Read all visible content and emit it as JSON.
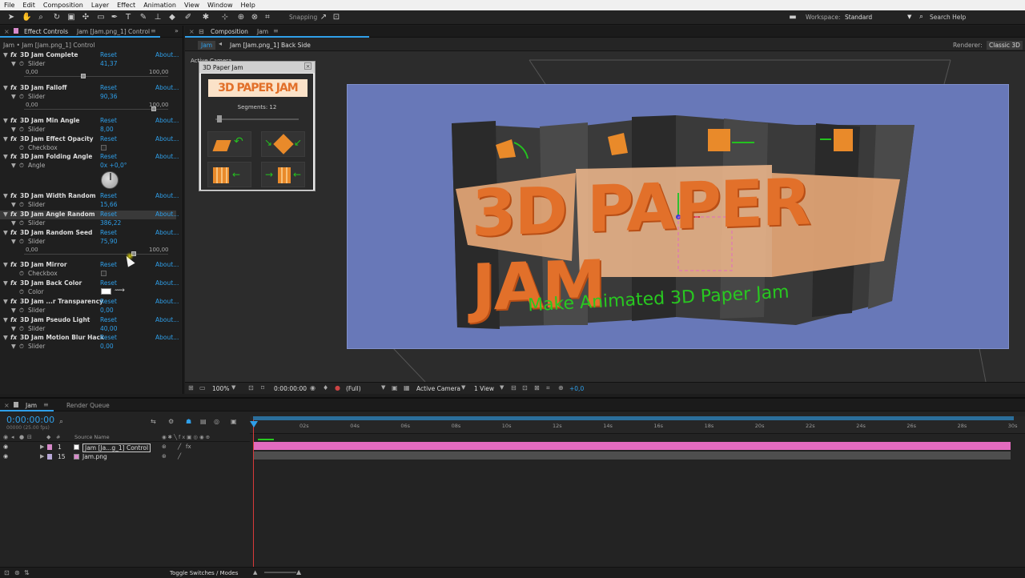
{
  "menu": [
    "File",
    "Edit",
    "Composition",
    "Layer",
    "Effect",
    "Animation",
    "View",
    "Window",
    "Help"
  ],
  "toolbar": {
    "snapping_label": "Snapping",
    "workspace_label": "Workspace:",
    "workspace_value": "Standard",
    "search_placeholder": "Search Help"
  },
  "effect_panel": {
    "tab_label": "Effect Controls",
    "tab_target": "Jam [Jam.png_1] Control",
    "header": "Jam • Jam [Jam.png_1] Control",
    "reset": "Reset",
    "about": "About...",
    "effects": [
      {
        "name": "3D Jam Complete",
        "sub": "Slider",
        "value": "41,37",
        "min": "0,00",
        "max": "100,00",
        "pos": 0.41
      },
      {
        "name": "3D Jam Falloff",
        "sub": "Slider",
        "value": "90,36",
        "min": "0,00",
        "max": "100,00",
        "pos": 0.9
      },
      {
        "name": "3D Jam Min Angle",
        "sub": "Slider",
        "value": "8,00"
      },
      {
        "name": "3D Jam Effect Opacity",
        "sub": "Checkbox",
        "value": ""
      },
      {
        "name": "3D Jam Folding Angle",
        "sub": "Angle",
        "value": "0x +0,0°"
      },
      {
        "name": "3D Jam Width Random",
        "sub": "Slider",
        "value": "15,66"
      },
      {
        "name": "3D Jam Angle Random",
        "sub": "Slider",
        "value": "386,22"
      },
      {
        "name": "3D Jam Random Seed",
        "sub": "Slider",
        "value": "75,90",
        "min": "0,00",
        "max": "100,00",
        "pos": 0.76
      },
      {
        "name": "3D Jam Mirror",
        "sub": "Checkbox",
        "value": ""
      },
      {
        "name": "3D Jam Back Color",
        "sub": "Color",
        "value": ""
      },
      {
        "name": "3D Jam ...r Transparency",
        "sub": "Slider",
        "value": "0,00"
      },
      {
        "name": "3D Jam Pseudo Light",
        "sub": "Slider",
        "value": "40,00"
      },
      {
        "name": "3D Jam Motion Blur Hack",
        "sub": "Slider",
        "value": "0,00"
      }
    ]
  },
  "plugin_panel": {
    "title": "3D Paper Jam",
    "logo": "3D PAPER JAM",
    "segments": "Segments: 12",
    "segments_value": 12,
    "segments_fraction": 0.05
  },
  "comp_panel": {
    "tab_label": "Composition",
    "tab_target": "Jam",
    "breadcrumb_1": "Jam",
    "breadcrumb_2": "Jam [Jam.png_1] Back Side",
    "renderer_label": "Renderer:",
    "renderer_value": "Classic 3D",
    "active_camera_overlay": "Active Camera",
    "scene_text_main": "3D PAPER JAM",
    "scene_text_sub": "Make Animated 3D Paper Jam",
    "footer": {
      "zoom": "100%",
      "timecode": "0:00:00:00",
      "resolution": "(Full)",
      "camera": "Active Camera",
      "view": "1 View",
      "exposure": "+0,0"
    }
  },
  "timeline": {
    "tab_label": "Jam",
    "render_queue_label": "Render Queue",
    "timecode": "0:00:00:00",
    "frame_info": "00000 (25.00 fps)",
    "source_name_header": "Source Name",
    "ruler": [
      "02s",
      "04s",
      "06s",
      "08s",
      "10s",
      "12s",
      "14s",
      "16s",
      "18s",
      "20s",
      "22s",
      "24s",
      "26s",
      "28s",
      "30s"
    ],
    "layers": [
      {
        "num": "1",
        "name": "Jam [Ja...g_1] Control",
        "color": "#d88acb"
      },
      {
        "num": "15",
        "name": "Jam.png",
        "color": "#b8a8d8"
      }
    ],
    "footer_label": "Toggle Switches / Modes"
  },
  "colors": {
    "accent_blue": "#2f9fe9",
    "layer_bar": "#e36bbf",
    "comp_bg": "#6878b8",
    "scene_orange": "#e2702a",
    "scene_green": "#28c820"
  }
}
